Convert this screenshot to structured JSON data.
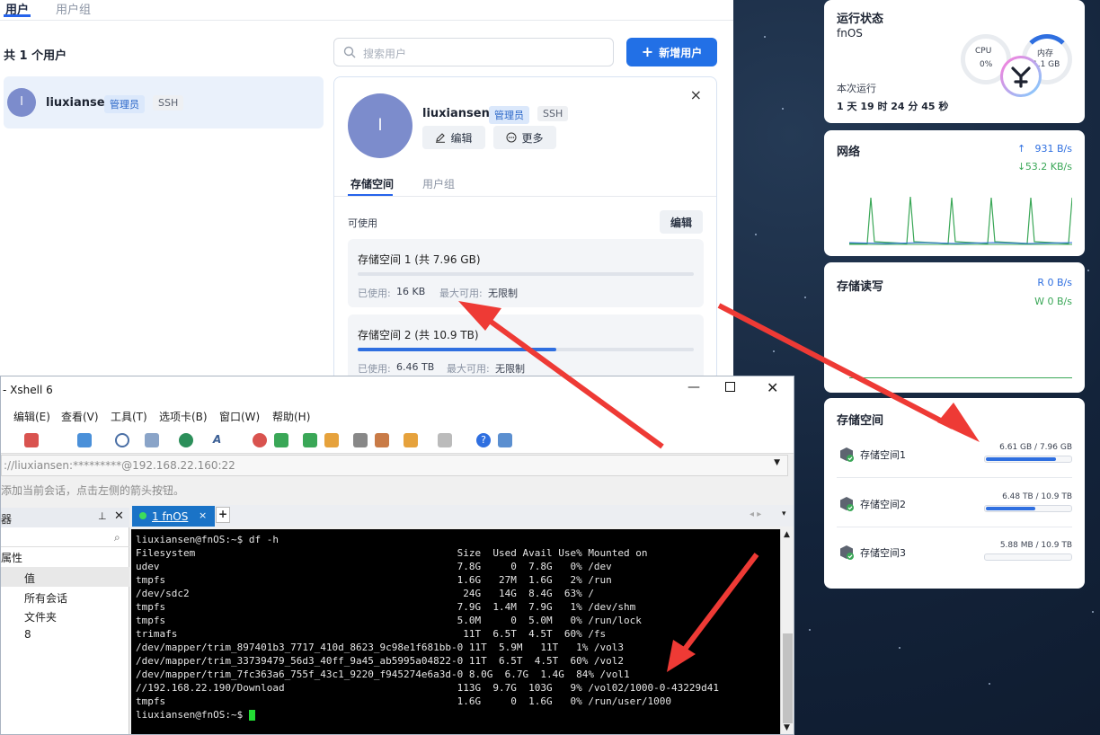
{
  "users_window": {
    "tabs": [
      "用户",
      "用户组"
    ],
    "count_label": "共 1 个用户",
    "search_placeholder": "搜索用户",
    "add_button": "新增用户",
    "user": {
      "avatar": "l",
      "name": "liuxiansen",
      "role_tag": "管理员",
      "ssh_tag": "SSH"
    },
    "detail": {
      "close": "×",
      "edit_button": "编辑",
      "more_button": "更多",
      "tabs": [
        "存储空间",
        "用户组"
      ],
      "available_label": "可使用",
      "edit_storage_button": "编辑",
      "storages": [
        {
          "title": "存储空间 1 (共 7.96 GB)",
          "used_label": "已使用:",
          "used": "16 KB",
          "max_label": "最大可用:",
          "max": "无限制",
          "fill": 0.0
        },
        {
          "title": "存储空间 2 (共 10.9 TB)",
          "used_label": "已使用:",
          "used": "6.46 TB",
          "max_label": "最大可用:",
          "max": "无限制",
          "fill": 0.59
        }
      ]
    }
  },
  "widgets": {
    "status": {
      "title": "运行状态",
      "host": "fnOS",
      "cpu_label": "CPU",
      "cpu_value": "0%",
      "mem_label": "内存",
      "mem_value": "1.1 GB",
      "uptime_label": "本次运行",
      "uptime": "1 天 19 时 24 分 45 秒"
    },
    "network": {
      "title": "网络",
      "up": "931 B/s",
      "down": "53.2 KB/s"
    },
    "disk_io": {
      "title": "存储读写",
      "read": "R 0 B/s",
      "write": "W 0 B/s"
    },
    "storage": {
      "title": "存储空间",
      "items": [
        {
          "name": "存储空间1",
          "usage": "6.61 GB / 7.96 GB",
          "fill": 0.83
        },
        {
          "name": "存储空间2",
          "usage": "6.48 TB / 10.9 TB",
          "fill": 0.59
        },
        {
          "name": "存储空间3",
          "usage": "5.88 MB / 10.9 TB",
          "fill": 0.0
        }
      ]
    },
    "colors": {
      "accent": "#2f6fe0",
      "network_green": "#3aa757"
    }
  },
  "xshell": {
    "title": "- Xshell 6",
    "menu": [
      "编辑(E)",
      "查看(V)",
      "工具(T)",
      "选项卡(B)",
      "窗口(W)",
      "帮助(H)"
    ],
    "address": "://liuxiansen:*********@192.168.22.160:22",
    "hint": "添加当前会话，点击左侧的箭头按钮。",
    "side_title": "器",
    "side_props": "属性",
    "side_value_header": "值",
    "side_rows": [
      "所有会话",
      "文件夹",
      "8"
    ],
    "tab_label": "1 fnOS",
    "terminal_lines": [
      "liuxiansen@fnOS:~$ df -h",
      "Filesystem                                            Size  Used Avail Use% Mounted on",
      "udev                                                  7.8G     0  7.8G   0% /dev",
      "tmpfs                                                 1.6G   27M  1.6G   2% /run",
      "/dev/sdc2                                              24G   14G  8.4G  63% /",
      "tmpfs                                                 7.9G  1.4M  7.9G   1% /dev/shm",
      "tmpfs                                                 5.0M     0  5.0M   0% /run/lock",
      "trimafs                                                11T  6.5T  4.5T  60% /fs",
      "/dev/mapper/trim_897401b3_7717_410d_8623_9c98e1f681bb-0 11T  5.9M   11T   1% /vol3",
      "/dev/mapper/trim_33739479_56d3_40ff_9a45_ab5995a04822-0 11T  6.5T  4.5T  60% /vol2",
      "/dev/mapper/trim_7fc363a6_755f_43c1_9220_f945274e6a3d-0 8.0G  6.7G  1.4G  84% /vol1",
      "//192.168.22.190/Download                             113G  9.7G  103G   9% /vol02/1000-0-43229d41",
      "tmpfs                                                 1.6G     0  1.6G   0% /run/user/1000",
      "liuxiansen@fnOS:~$ "
    ]
  }
}
